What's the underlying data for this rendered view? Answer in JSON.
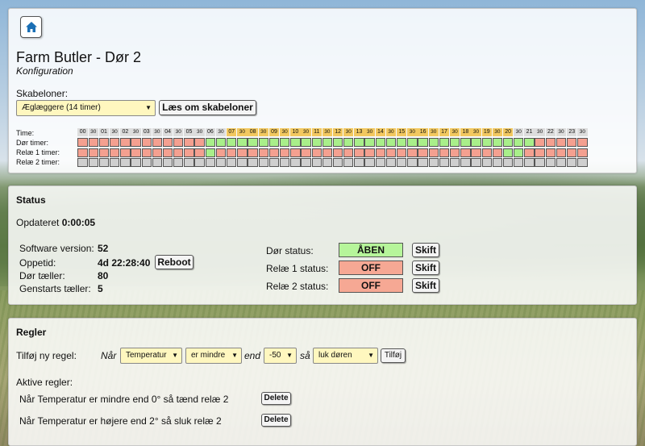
{
  "config": {
    "title": "Farm Butler - Dør 2",
    "subtitle": "Konfiguration",
    "template_label": "Skabeloner:",
    "template_selected": "Æglæggere (14 timer)",
    "read_button": "Læs om skabeloner",
    "row_labels": {
      "time": "Time:",
      "door": "Dør timer:",
      "relay1": "Relæ 1 timer:",
      "relay2": "Relæ 2 timer:"
    },
    "time_slots": [
      "00",
      "30",
      "01",
      "30",
      "02",
      "30",
      "03",
      "30",
      "04",
      "30",
      "05",
      "30",
      "06",
      "30",
      "07",
      "30",
      "08",
      "30",
      "09",
      "30",
      "10",
      "30",
      "11",
      "30",
      "12",
      "30",
      "13",
      "30",
      "14",
      "30",
      "15",
      "30",
      "16",
      "30",
      "17",
      "30",
      "18",
      "30",
      "19",
      "30",
      "20",
      "30",
      "21",
      "30",
      "22",
      "30",
      "23",
      "30"
    ],
    "door_hours": [
      0,
      0,
      0,
      0,
      0,
      0,
      0,
      0,
      0,
      0,
      0,
      0,
      1,
      1,
      1,
      1,
      1,
      1,
      1,
      1,
      1,
      1,
      1,
      1,
      1,
      1,
      1,
      1,
      1,
      1,
      1,
      1,
      1,
      1,
      1,
      1,
      1,
      1,
      1,
      1,
      1,
      1,
      1,
      0,
      0,
      0,
      0,
      0
    ],
    "relay1_hours": [
      0,
      0,
      0,
      0,
      0,
      0,
      0,
      0,
      0,
      0,
      0,
      0,
      1,
      0,
      0,
      0,
      0,
      0,
      0,
      0,
      0,
      0,
      0,
      0,
      0,
      0,
      0,
      0,
      0,
      0,
      0,
      0,
      0,
      0,
      0,
      0,
      0,
      0,
      0,
      0,
      1,
      1,
      0,
      0,
      0,
      0,
      0,
      0
    ],
    "relay2_hours": [
      -1,
      -1,
      -1,
      -1,
      -1,
      -1,
      -1,
      -1,
      -1,
      -1,
      -1,
      -1,
      -1,
      -1,
      -1,
      -1,
      -1,
      -1,
      -1,
      -1,
      -1,
      -1,
      -1,
      -1,
      -1,
      -1,
      -1,
      -1,
      -1,
      -1,
      -1,
      -1,
      -1,
      -1,
      -1,
      -1,
      -1,
      -1,
      -1,
      -1,
      -1,
      -1,
      -1,
      -1,
      -1,
      -1,
      -1,
      -1
    ],
    "day_hours": [
      14,
      40
    ]
  },
  "status": {
    "heading": "Status",
    "updated_label": "Opdateret",
    "updated_value": "0:00:05",
    "software_label": "Software version:",
    "software_value": "52",
    "uptime_label": "Oppetid:",
    "uptime_value": "4d 22:28:40",
    "reboot_button": "Reboot",
    "door_counter_label": "Dør tæller:",
    "door_counter_value": "80",
    "restart_counter_label": "Genstarts tæller:",
    "restart_counter_value": "5",
    "door_status_label": "Dør status:",
    "door_status_value": "ÅBEN",
    "relay1_status_label": "Relæ 1 status:",
    "relay1_status_value": "OFF",
    "relay2_status_label": "Relæ 2 status:",
    "relay2_status_value": "OFF",
    "toggle_button": "Skift"
  },
  "rules": {
    "heading": "Regler",
    "add_label": "Tilføj ny regel:",
    "when_word": "Når",
    "sensor_selected": "Temperatur",
    "comparison_selected": "er mindre",
    "than_word": "end",
    "value_selected": "-50",
    "then_word": "så",
    "action_selected": "luk døren",
    "add_button": "Tilføj",
    "active_label": "Aktive regler:",
    "active_rules": [
      "Når Temperatur er mindre end 0° så tænd relæ 2",
      "Når Temperatur er højere end 2° så sluk relæ 2"
    ],
    "delete_button": "Delete"
  },
  "colors": {
    "on": "#a9ef8a",
    "off": "#f4a090",
    "none": "#cfcfcf",
    "day": "#f2c860",
    "select": "#fff7bf",
    "home_icon": "#1a6fb5"
  }
}
